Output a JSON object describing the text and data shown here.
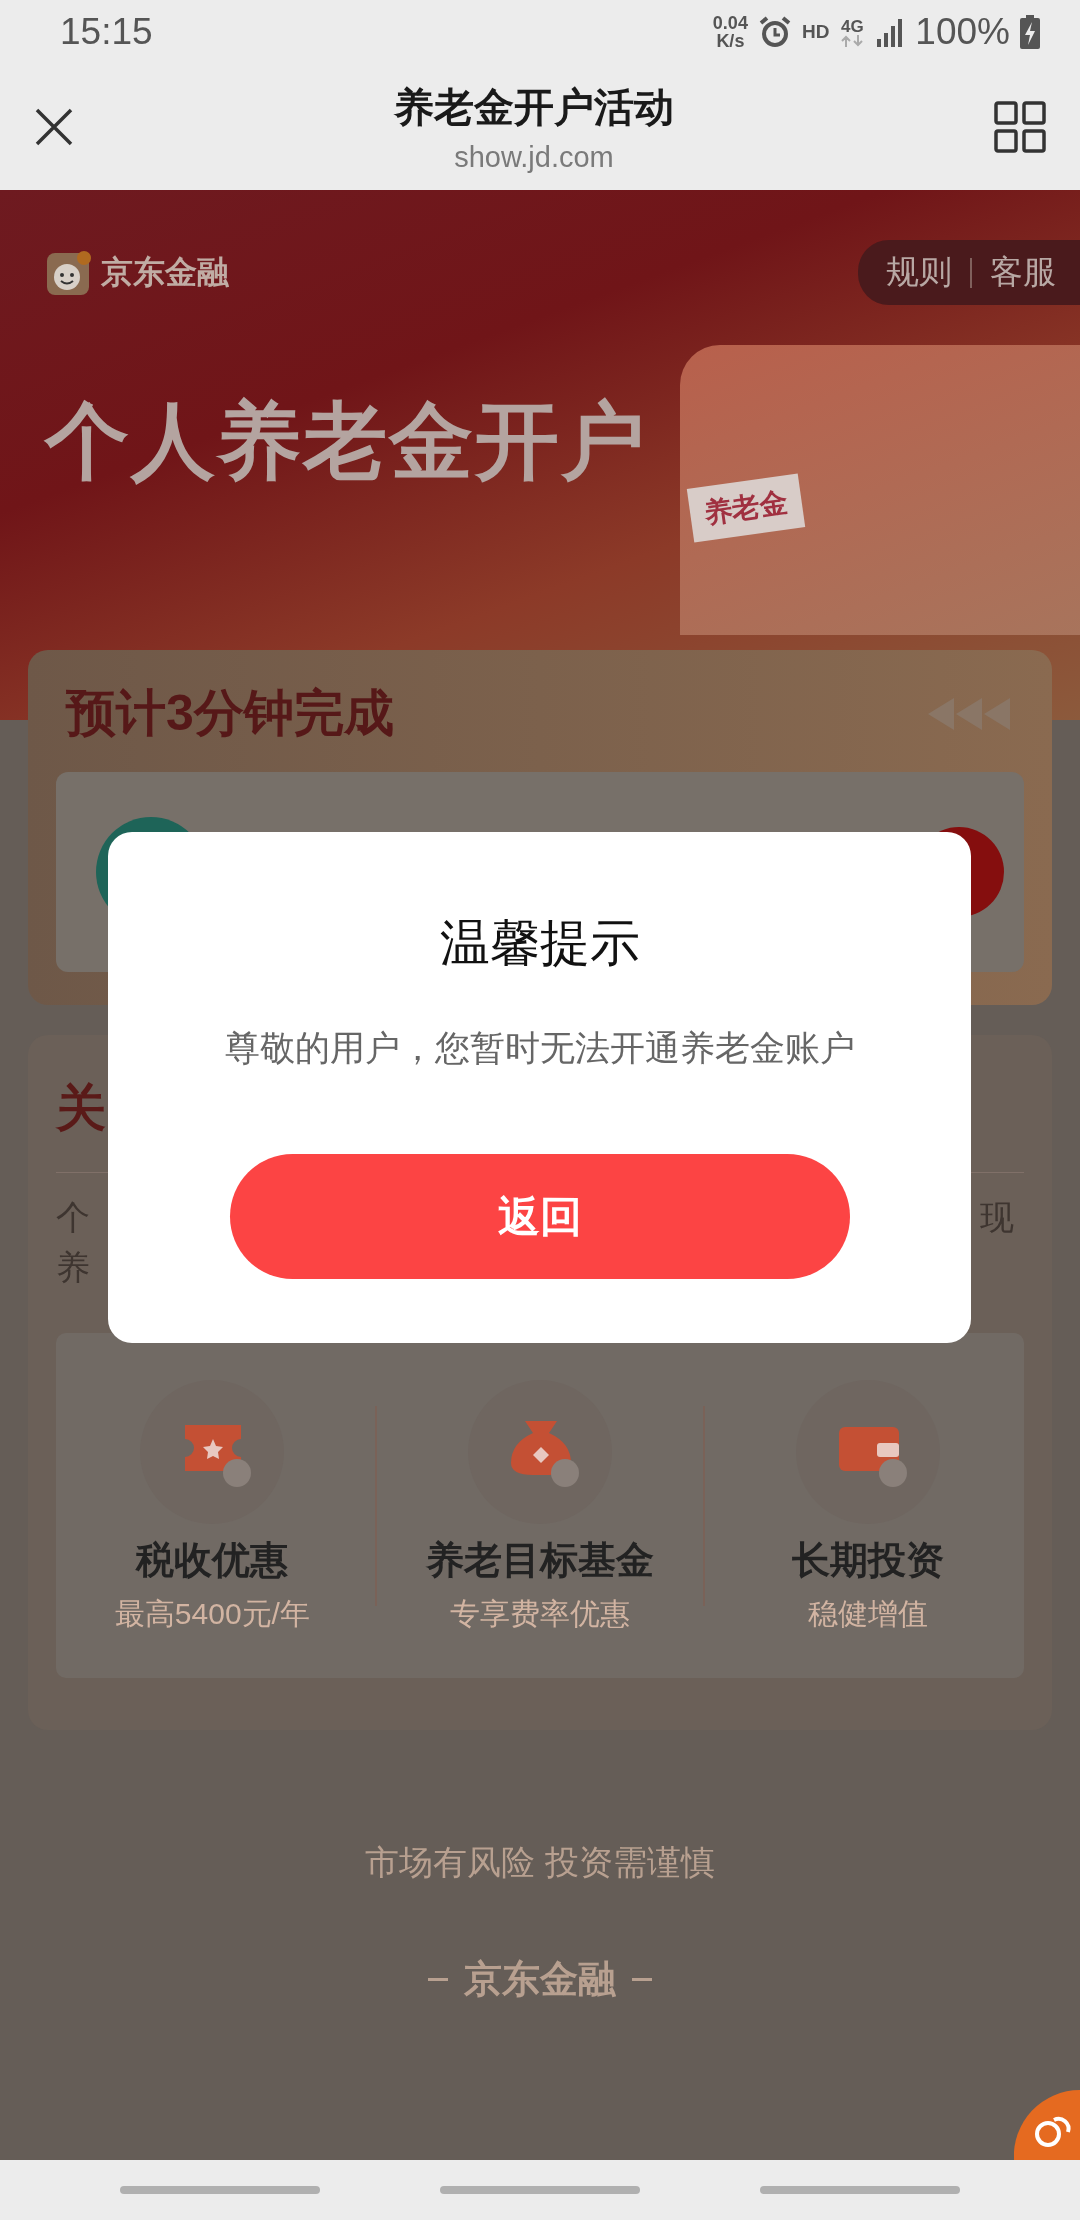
{
  "status_bar": {
    "time": "15:15",
    "net_speed_value": "0.04",
    "net_speed_unit": "K/s",
    "hd": "HD",
    "network": "4G",
    "battery": "100%"
  },
  "header": {
    "title": "养老金开户活动",
    "url": "show.jd.com"
  },
  "banner": {
    "brand": "京东金融",
    "links": [
      "规则",
      "客服"
    ],
    "headline": "个人养老金开户",
    "illustration_tag": "养老金"
  },
  "steps_card": {
    "title": "预计3分钟完成"
  },
  "about_card": {
    "heading": "关",
    "text_lines": [
      {
        "left": "个",
        "right": "现"
      },
      {
        "left": "养"
      }
    ],
    "features": [
      {
        "kind": "ticket",
        "title": "税收优惠",
        "subtitle": "最高5400元/年"
      },
      {
        "kind": "bag",
        "title": "养老目标基金",
        "subtitle": "专享费率优惠"
      },
      {
        "kind": "wallet",
        "title": "长期投资",
        "subtitle": "稳健增值"
      }
    ]
  },
  "footer": {
    "disclaimer": "市场有风险 投资需谨慎",
    "brand": "京东金融"
  },
  "dialog": {
    "title": "温馨提示",
    "message": "尊敬的用户，您暂时无法开通养老金账户",
    "button": "返回"
  }
}
